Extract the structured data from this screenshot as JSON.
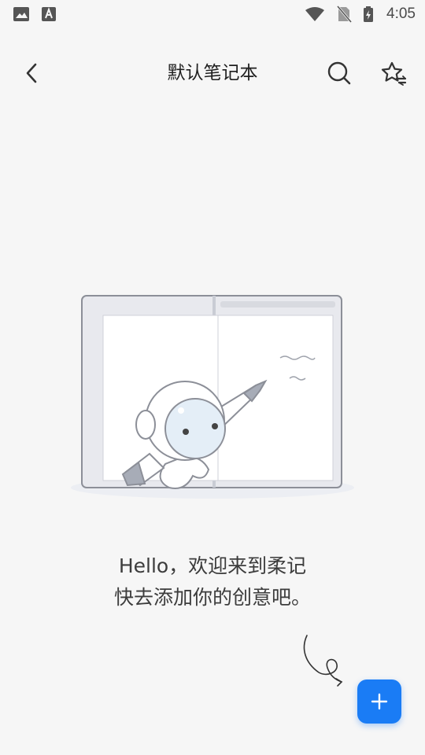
{
  "status_bar": {
    "time": "4:05",
    "icons": [
      "image-icon",
      "text-a-icon",
      "wifi-icon",
      "no-sim-icon",
      "battery-charging-icon"
    ]
  },
  "header": {
    "title": "默认笔记本",
    "back_icon": "chevron-left-icon",
    "search_icon": "search-icon",
    "star_icon": "star-sort-icon"
  },
  "empty_state": {
    "illustration": "astronaut-with-pen-notebook",
    "line1": "Hello，欢迎来到柔记",
    "line2": "快去添加你的创意吧。"
  },
  "fab": {
    "icon": "plus-icon",
    "color": "#1a7cf5"
  }
}
